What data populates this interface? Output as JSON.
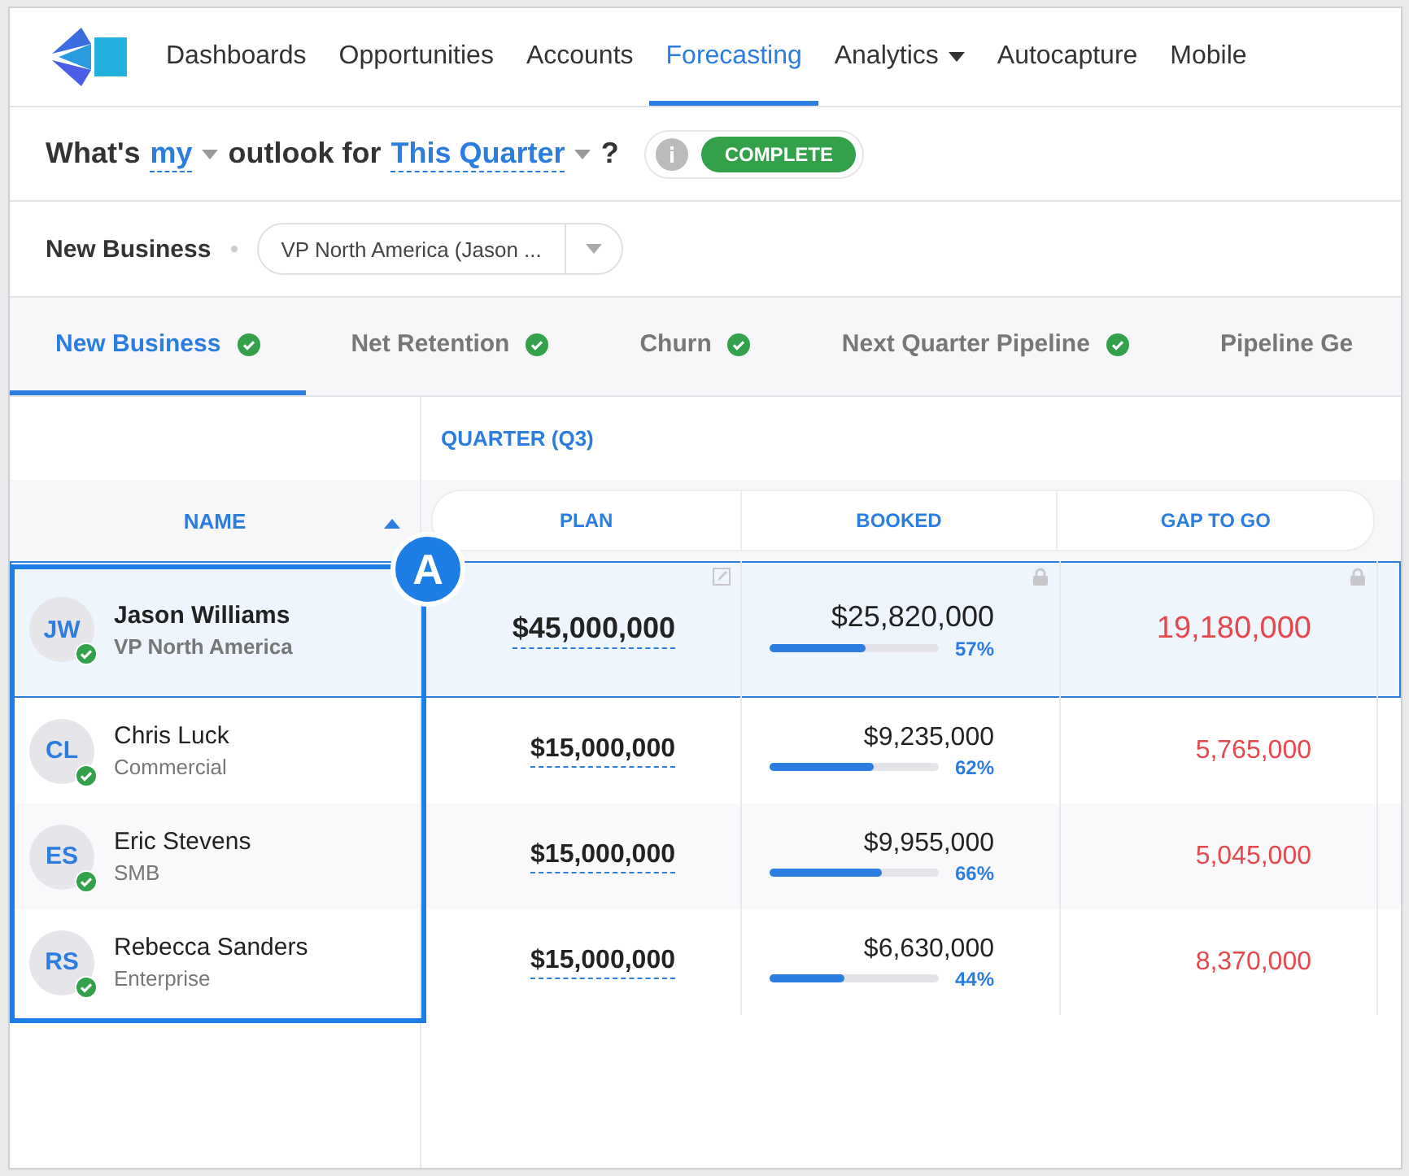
{
  "nav": {
    "items": [
      {
        "label": "Dashboards",
        "selected": false,
        "dropdown": false
      },
      {
        "label": "Opportunities",
        "selected": false,
        "dropdown": false
      },
      {
        "label": "Accounts",
        "selected": false,
        "dropdown": false
      },
      {
        "label": "Forecasting",
        "selected": true,
        "dropdown": false
      },
      {
        "label": "Analytics",
        "selected": false,
        "dropdown": true
      },
      {
        "label": "Autocapture",
        "selected": false,
        "dropdown": false
      },
      {
        "label": "Mobile",
        "selected": false,
        "dropdown": false
      }
    ]
  },
  "question": {
    "prefix": "What's",
    "who": "my",
    "middle": "outlook for",
    "period": "This Quarter",
    "suffix": "?",
    "status": "COMPLETE"
  },
  "filter": {
    "label": "New Business",
    "value": "VP North America (Jason ..."
  },
  "tabs": [
    {
      "label": "New Business",
      "selected": true,
      "complete": true
    },
    {
      "label": "Net Retention",
      "selected": false,
      "complete": true
    },
    {
      "label": "Churn",
      "selected": false,
      "complete": true
    },
    {
      "label": "Next Quarter Pipeline",
      "selected": false,
      "complete": true
    },
    {
      "label": "Pipeline Ge",
      "selected": false,
      "complete": false
    }
  ],
  "table": {
    "group": "QUARTER (Q3)",
    "columns": [
      "NAME",
      "PLAN",
      "BOOKED",
      "GAP TO GO"
    ],
    "rows": [
      {
        "initials": "JW",
        "name": "Jason Williams",
        "role": "VP North America",
        "plan": "$45,000,000",
        "booked": "$25,820,000",
        "level": 0.57,
        "percent": "57%",
        "gap": "19,180,000",
        "selected": true,
        "locked": true
      },
      {
        "initials": "CL",
        "name": "Chris Luck",
        "role": "Commercial",
        "plan": "$15,000,000",
        "booked": "$9,235,000",
        "level": 0.62,
        "percent": "62%",
        "gap": "5,765,000",
        "selected": false,
        "locked": false
      },
      {
        "initials": "ES",
        "name": "Eric Stevens",
        "role": "SMB",
        "plan": "$15,000,000",
        "booked": "$9,955,000",
        "level": 0.66,
        "percent": "66%",
        "gap": "5,045,000",
        "selected": false,
        "locked": false
      },
      {
        "initials": "RS",
        "name": "Rebecca Sanders",
        "role": "Enterprise",
        "plan": "$15,000,000",
        "booked": "$6,630,000",
        "level": 0.44,
        "percent": "44%",
        "gap": "8,370,000",
        "selected": false,
        "locked": false
      }
    ]
  },
  "annotation": {
    "label": "A"
  }
}
